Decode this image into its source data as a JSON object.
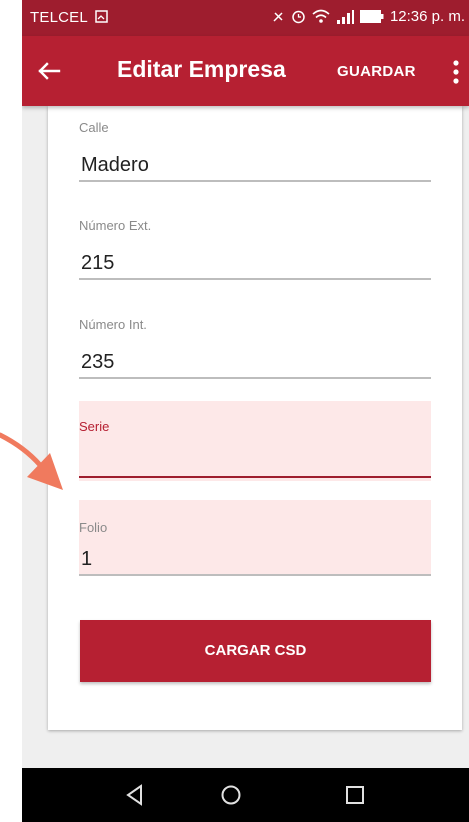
{
  "statusbar": {
    "carrier": "TELCEL",
    "time": "12:36 p. m."
  },
  "appbar": {
    "title": "Editar Empresa",
    "save_label": "GUARDAR"
  },
  "form": {
    "calle": {
      "label": "Calle",
      "value": "Madero"
    },
    "numero_ext": {
      "label": "Número Ext.",
      "value": "215"
    },
    "numero_int": {
      "label": "Número Int.",
      "value": "235"
    },
    "serie": {
      "label": "Serie",
      "value": ""
    },
    "folio": {
      "label": "Folio",
      "value": "1"
    }
  },
  "actions": {
    "cargar_csd_label": "CARGAR CSD"
  },
  "colors": {
    "accent": "#b62032",
    "statusbar": "#9e1d2e",
    "highlight": "#fde8e8",
    "annotation_arrow": "#f07a5e"
  },
  "icons": [
    "back-arrow-icon",
    "more-vert-icon",
    "sim-icon",
    "vibrate-icon",
    "alarm-icon",
    "wifi-icon",
    "signal-icon",
    "battery-icon",
    "nav-back-icon",
    "nav-home-icon",
    "nav-recents-icon",
    "annotation-arrow-icon"
  ]
}
